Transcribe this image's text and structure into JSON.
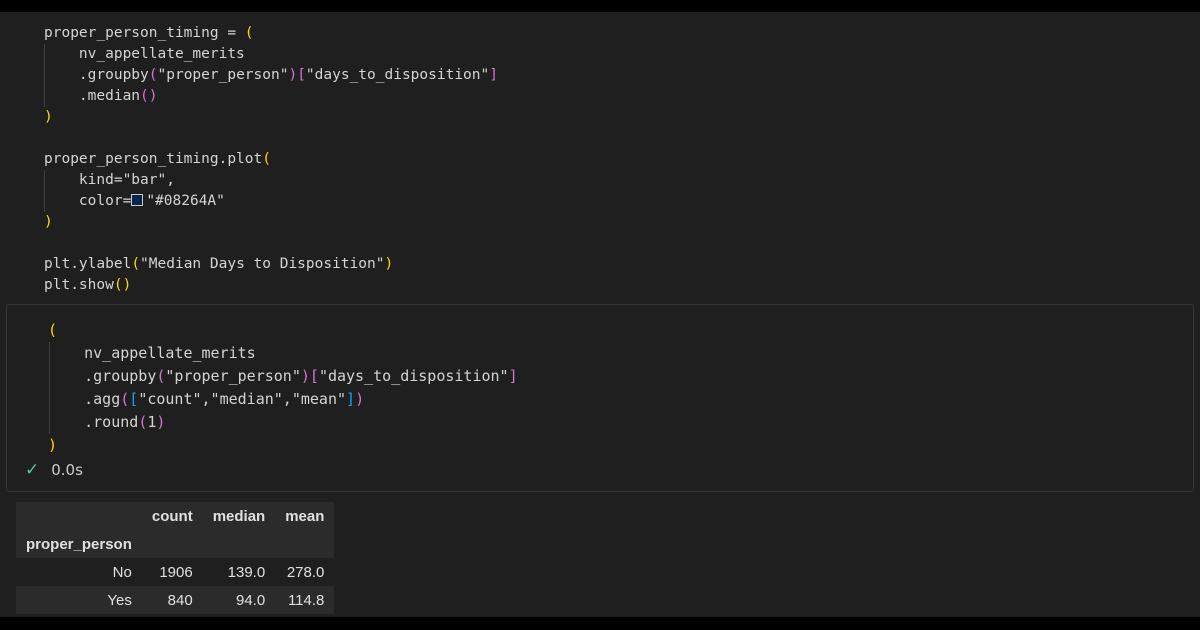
{
  "cell1": {
    "lines": [
      [
        {
          "t": "proper_person_timing = ",
          "c": ""
        },
        {
          "t": "(",
          "c": "p1"
        }
      ],
      [
        {
          "t": "    nv_appellate_merits",
          "c": ""
        }
      ],
      [
        {
          "t": "    .groupby",
          "c": ""
        },
        {
          "t": "(",
          "c": "p2"
        },
        {
          "t": "\"proper_person\"",
          "c": ""
        },
        {
          "t": ")",
          "c": "p2"
        },
        {
          "t": "[",
          "c": "p2"
        },
        {
          "t": "\"days_to_disposition\"",
          "c": ""
        },
        {
          "t": "]",
          "c": "p2"
        }
      ],
      [
        {
          "t": "    .median",
          "c": ""
        },
        {
          "t": "()",
          "c": "p2"
        }
      ],
      [
        {
          "t": ")",
          "c": "p1"
        }
      ],
      [
        {
          "t": "",
          "c": ""
        }
      ],
      [
        {
          "t": "proper_person_timing.plot",
          "c": ""
        },
        {
          "t": "(",
          "c": "p1"
        }
      ],
      [
        {
          "t": "    kind=\"bar\",",
          "c": ""
        }
      ],
      [
        {
          "t": "    color=",
          "c": ""
        },
        {
          "t": "\"#08264A\"",
          "c": "",
          "swatch": "#08264A"
        }
      ],
      [
        {
          "t": ")",
          "c": "p1"
        }
      ],
      [
        {
          "t": "",
          "c": ""
        }
      ],
      [
        {
          "t": "plt.ylabel",
          "c": ""
        },
        {
          "t": "(",
          "c": "p1"
        },
        {
          "t": "\"Median Days to Disposition\"",
          "c": ""
        },
        {
          "t": ")",
          "c": "p1"
        }
      ],
      [
        {
          "t": "plt.show",
          "c": ""
        },
        {
          "t": "()",
          "c": "p1"
        }
      ]
    ]
  },
  "cell2": {
    "lines": [
      [
        {
          "t": "(",
          "c": "p1"
        }
      ],
      [
        {
          "t": "    nv_appellate_merits",
          "c": ""
        }
      ],
      [
        {
          "t": "    .groupby",
          "c": ""
        },
        {
          "t": "(",
          "c": "p2"
        },
        {
          "t": "\"proper_person\"",
          "c": ""
        },
        {
          "t": ")",
          "c": "p2"
        },
        {
          "t": "[",
          "c": "p2"
        },
        {
          "t": "\"days_to_disposition\"",
          "c": ""
        },
        {
          "t": "]",
          "c": "p2"
        }
      ],
      [
        {
          "t": "    .agg",
          "c": ""
        },
        {
          "t": "(",
          "c": "p2"
        },
        {
          "t": "[",
          "c": "p3"
        },
        {
          "t": "\"count\",\"median\",\"mean\"",
          "c": ""
        },
        {
          "t": "]",
          "c": "p3"
        },
        {
          "t": ")",
          "c": "p2"
        }
      ],
      [
        {
          "t": "    .round",
          "c": ""
        },
        {
          "t": "(",
          "c": "p2"
        },
        {
          "t": "1",
          "c": ""
        },
        {
          "t": ")",
          "c": "p2"
        }
      ],
      [
        {
          "t": ")",
          "c": "p1"
        }
      ]
    ],
    "status_icon": "checkmark-icon",
    "elapsed": "0.0s"
  },
  "output_table": {
    "columns": [
      "count",
      "median",
      "mean"
    ],
    "index_name": "proper_person",
    "rows": [
      {
        "label": "No",
        "values": [
          "1906",
          "139.0",
          "278.0"
        ]
      },
      {
        "label": "Yes",
        "values": [
          "840",
          "94.0",
          "114.8"
        ]
      }
    ]
  },
  "colors": {
    "background": "#1f1f1f",
    "bracket_gold": "#ffd700",
    "bracket_pink": "#da70d6",
    "bracket_blue": "#179fff",
    "swatch": "#08264A"
  }
}
